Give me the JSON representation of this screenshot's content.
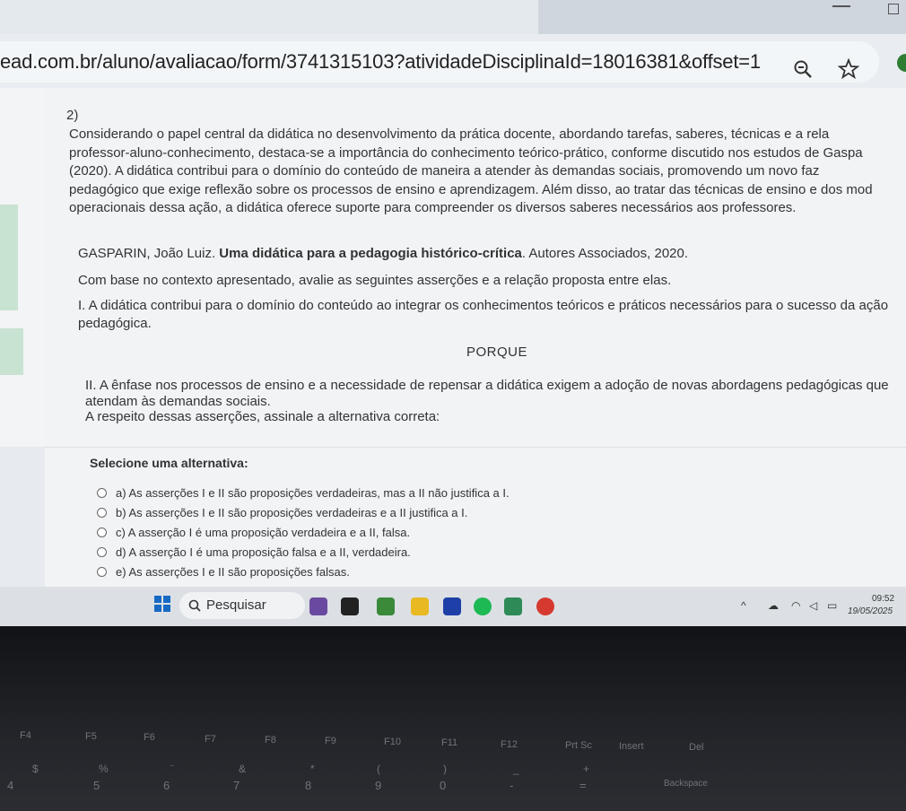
{
  "browser": {
    "url": "ead.com.br/aluno/avaliacao/form/3741315103?atividadeDisciplinaId=18016381&offset=1",
    "icons": [
      "zoom-icon",
      "star-icon"
    ]
  },
  "question": {
    "number": "2)",
    "paragraph_lines": [
      "Considerando o papel central da didática no desenvolvimento da prática docente, abordando tarefas, saberes, técnicas e a rela",
      "professor-aluno-conhecimento, destaca-se a importância do conhecimento teórico-prático, conforme discutido nos estudos de Gaspa",
      "(2020). A didática contribui para o domínio do conteúdo de maneira a atender às demandas sociais, promovendo um novo faz",
      "pedagógico que exige reflexão sobre os processos de ensino e aprendizagem. Além disso, ao tratar das técnicas de ensino e dos mod",
      "operacionais dessa ação, a didática oferece suporte para compreender os diversos saberes necessários aos professores."
    ],
    "reference_author": "GASPARIN, João Luiz. ",
    "reference_title": "Uma didática para a pedagogia histórico-crítica",
    "reference_rest": ". Autores Associados, 2020.",
    "intro": "Com base no contexto apresentado, avalie as seguintes asserções e a relação proposta entre elas.",
    "assertion1_lines": [
      "I. A didática contribui para o domínio do conteúdo ao integrar os conhecimentos teóricos e práticos necessários para o sucesso da ação",
      "pedagógica."
    ],
    "connector": "PORQUE",
    "assertion2_lines": [
      "II. A ênfase nos processos de ensino e a necessidade de repensar a didática exigem a adoção de novas abordagens pedagógicas que",
      "atendam às demandas sociais."
    ],
    "prompt": "A respeito dessas asserções, assinale a alternativa correta:",
    "select_label": "Selecione uma alternativa:",
    "options": [
      "a) As asserções I e II são proposições verdadeiras, mas a II não justifica a I.",
      "b) As asserções I e II são proposições verdadeiras e a II justifica a I.",
      "c) A asserção I é uma proposição verdadeira e a II, falsa.",
      "d) A asserção I é uma proposição falsa e a II, verdadeira.",
      "e) As asserções I e II são proposições falsas."
    ]
  },
  "taskbar": {
    "search_label": "Pesquisar",
    "time": "09:52",
    "date": "19/05/2025",
    "app_icons": [
      "widgets-icon",
      "terminal-icon",
      "app-icon",
      "file-explorer-icon",
      "store-icon",
      "spotify-icon",
      "app-icon-2",
      "chrome-icon"
    ],
    "app_colors": [
      "#6a4aa0",
      "#222222",
      "#3a8a3a",
      "#e8b923",
      "#1e3fa8",
      "#1db954",
      "#2e8b57",
      "#d63a2f"
    ]
  },
  "keyboard": {
    "fkeys": [
      "F4",
      "F5",
      "F6",
      "F7",
      "F8",
      "F9",
      "F10",
      "F11",
      "F12",
      "Prt Sc",
      "Insert",
      "Del"
    ],
    "numbers": [
      "4",
      "5",
      "6",
      "7",
      "8",
      "9",
      "0",
      "-",
      "=",
      "Backspace"
    ],
    "symbols": [
      "$",
      "%",
      "¨",
      "&",
      "*",
      "(",
      ")",
      "_",
      "+"
    ]
  }
}
